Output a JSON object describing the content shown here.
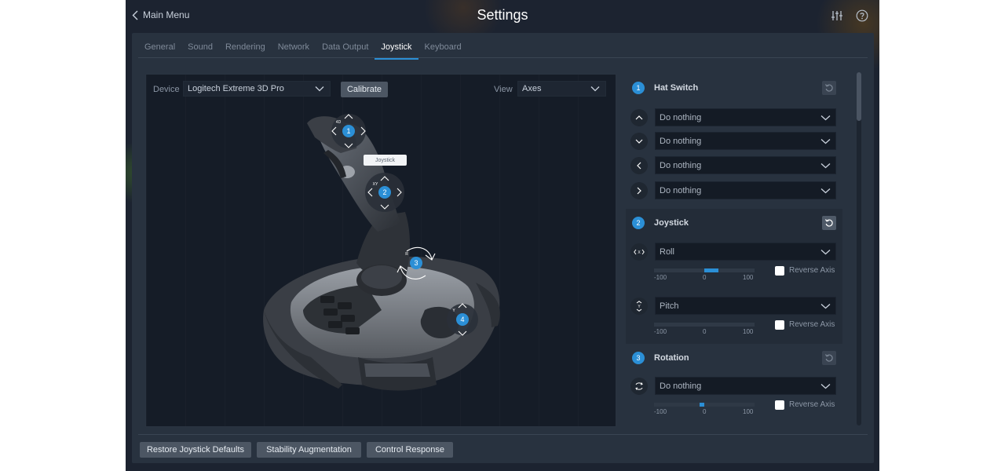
{
  "header": {
    "back_label": "Main Menu",
    "title": "Settings",
    "icons": [
      "sliders-icon",
      "help-icon"
    ]
  },
  "tabs": [
    {
      "label": "General",
      "active": false
    },
    {
      "label": "Sound",
      "active": false
    },
    {
      "label": "Rendering",
      "active": false
    },
    {
      "label": "Network",
      "active": false
    },
    {
      "label": "Data Output",
      "active": false
    },
    {
      "label": "Joystick",
      "active": true
    },
    {
      "label": "Keyboard",
      "active": false
    }
  ],
  "viewer": {
    "device_label": "Device",
    "device_value": "Logitech Extreme 3D Pro",
    "calibrate_label": "Calibrate",
    "view_label": "View",
    "view_value": "Axes",
    "tooltip": "Joystick",
    "markers": [
      {
        "number": "1",
        "tag": "4D"
      },
      {
        "number": "2",
        "tag": "XY"
      },
      {
        "number": "3",
        "tag": "R"
      },
      {
        "number": "4",
        "tag": "Y"
      }
    ]
  },
  "sections": {
    "hat": {
      "number": "1",
      "title": "Hat Switch",
      "rows": [
        {
          "icon": "chevron-up-icon",
          "value": "Do nothing"
        },
        {
          "icon": "chevron-down-icon",
          "value": "Do nothing"
        },
        {
          "icon": "chevron-left-icon",
          "value": "Do nothing"
        },
        {
          "icon": "chevron-right-icon",
          "value": "Do nothing"
        }
      ]
    },
    "joystick": {
      "number": "2",
      "title": "Joystick",
      "axes": [
        {
          "icon": "axis-x-icon",
          "value": "Roll",
          "tick_min": "-100",
          "tick_mid": "0",
          "tick_max": "100",
          "level": 0.28,
          "reverse_label": "Reverse Axis"
        },
        {
          "icon": "axis-y-icon",
          "value": "Pitch",
          "tick_min": "-100",
          "tick_mid": "0",
          "tick_max": "100",
          "level": 0.0,
          "reverse_label": "Reverse Axis"
        }
      ]
    },
    "rotation": {
      "number": "3",
      "title": "Rotation",
      "axes": [
        {
          "icon": "axis-rotate-icon",
          "value": "Do nothing",
          "tick_min": "-100",
          "tick_mid": "0",
          "tick_max": "100",
          "level": -0.1,
          "reverse_label": "Reverse Axis"
        }
      ]
    }
  },
  "footer": {
    "restore_label": "Restore Joystick Defaults",
    "stability_label": "Stability Augmentation",
    "control_label": "Control Response"
  },
  "colors": {
    "accent": "#2b8fd6",
    "panel": "#28323f",
    "background": "#1c2330"
  }
}
